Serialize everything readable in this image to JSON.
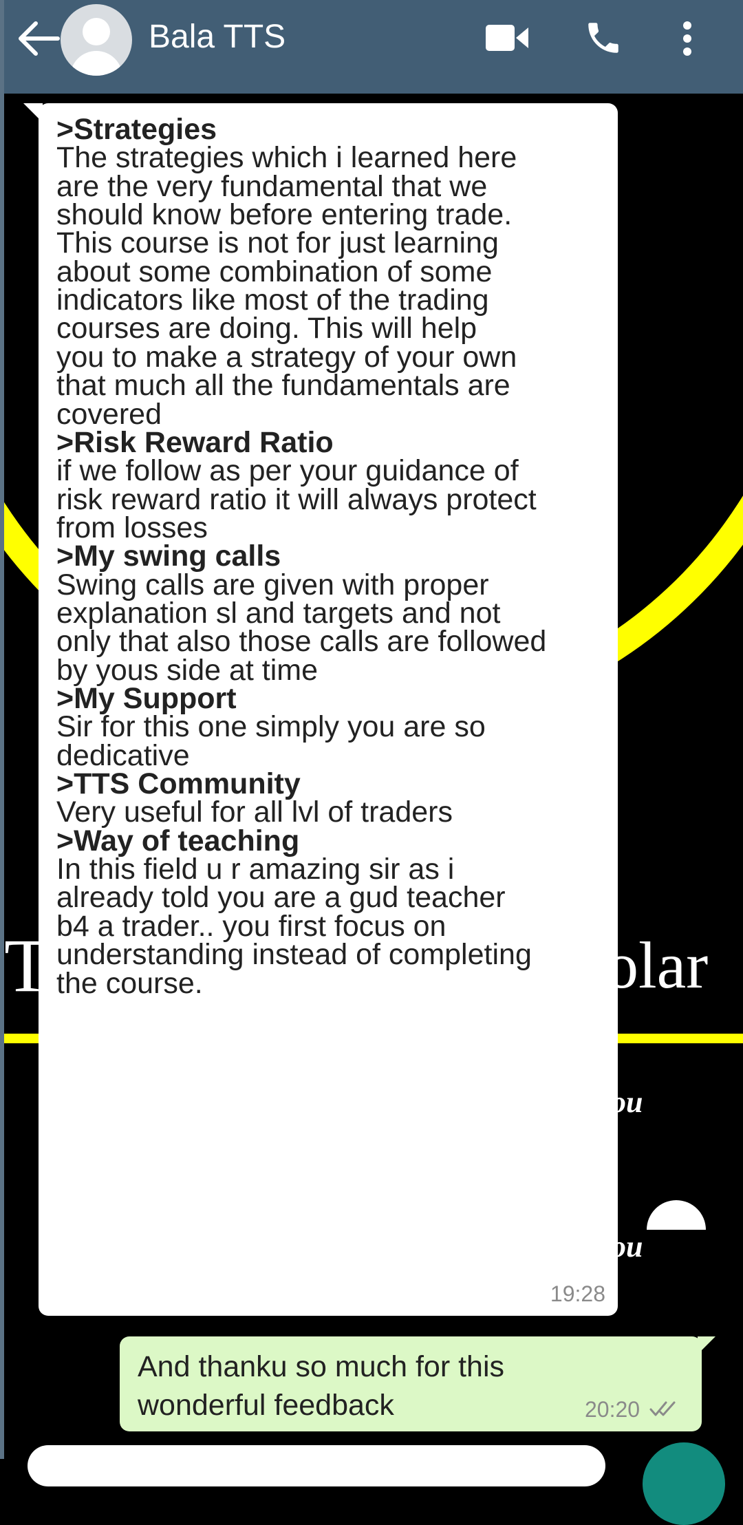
{
  "header": {
    "contact_name": "Bala TTS",
    "icons": [
      "back-arrow-icon",
      "avatar",
      "video-call-icon",
      "voice-call-icon",
      "more-options-icon"
    ]
  },
  "wallpaper": {
    "letter_left": "T",
    "word_right": "olar",
    "fragment_1": "ou",
    "fragment_2": "ou"
  },
  "incoming": {
    "lines": [
      {
        "text": ">Strategies",
        "bold": true
      },
      {
        "text": " The strategies which i learned here",
        "bold": false
      },
      {
        "text": "are the very fundamental that we",
        "bold": false
      },
      {
        "text": "should know before entering trade.",
        "bold": false
      },
      {
        "text": "This course is not for just learning",
        "bold": false
      },
      {
        "text": "about some combination of some",
        "bold": false
      },
      {
        "text": "indicators like most of the trading",
        "bold": false
      },
      {
        "text": "courses are doing. This will help",
        "bold": false
      },
      {
        "text": "you to make a strategy of your own",
        "bold": false
      },
      {
        "text": "that much all the fundamentals are",
        "bold": false
      },
      {
        "text": "covered",
        "bold": false
      },
      {
        "text": " >Risk Reward Ratio",
        "bold": true
      },
      {
        "text": " if we follow as per your guidance of",
        "bold": false
      },
      {
        "text": "risk reward ratio it will always protect",
        "bold": false
      },
      {
        "text": "from losses",
        "bold": false
      },
      {
        "text": " >My swing calls",
        "bold": true
      },
      {
        "text": " Swing calls are given with proper",
        "bold": false
      },
      {
        "text": "explanation sl and targets and not",
        "bold": false
      },
      {
        "text": "only that also those calls are followed",
        "bold": false
      },
      {
        "text": "by yous side at time",
        "bold": false
      },
      {
        "text": " >My Support",
        "bold": true
      },
      {
        "text": " Sir for this one simply you are so",
        "bold": false
      },
      {
        "text": "dedicative",
        "bold": false
      },
      {
        "text": " >TTS Community",
        "bold": true
      },
      {
        "text": "Very useful for all lvl of traders",
        "bold": false
      },
      {
        "text": " >Way of teaching",
        "bold": true
      },
      {
        "text": " In this field u r amazing sir as i",
        "bold": false
      },
      {
        "text": "already told you are a gud teacher",
        "bold": false
      },
      {
        "text": "b4 a trader.. you first focus on",
        "bold": false
      },
      {
        "text": "understanding instead of completing",
        "bold": false
      },
      {
        "text": "the course.",
        "bold": false
      }
    ],
    "time": "19:28"
  },
  "outgoing": {
    "lines": [
      "And thanku so much for this",
      "wonderful feedback"
    ],
    "time": "20:20",
    "status_icon": "double-check-icon"
  }
}
